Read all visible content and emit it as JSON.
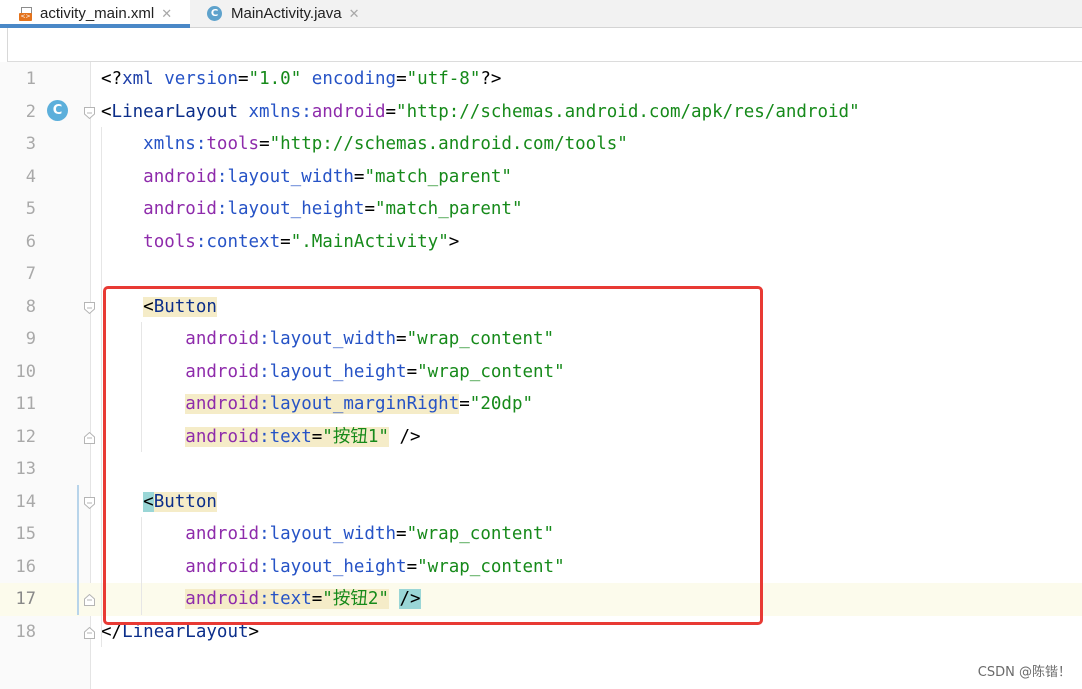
{
  "tabs": [
    {
      "label": "activity_main.xml",
      "icon": "xml-file-icon",
      "active": true
    },
    {
      "label": "MainActivity.java",
      "icon": "java-class-icon",
      "active": false
    }
  ],
  "tab_close_glyph": "✕",
  "gutter_badge": "C",
  "xml_icon_text": "<>",
  "lines": [
    {
      "n": "1",
      "parts": [
        [
          "plain",
          "<?"
        ],
        [
          "b",
          "xml "
        ],
        [
          "attr",
          "version"
        ],
        [
          "plain",
          "="
        ],
        [
          "str",
          "\"1.0\""
        ],
        [
          "plain",
          " "
        ],
        [
          "attr",
          "encoding"
        ],
        [
          "plain",
          "="
        ],
        [
          "str",
          "\"utf-8\""
        ],
        [
          "plain",
          "?>"
        ]
      ]
    },
    {
      "n": "2",
      "parts": [
        [
          "plain",
          "<"
        ],
        [
          "t",
          "LinearLayout "
        ],
        [
          "attr",
          "xmlns:"
        ],
        [
          "ns",
          "android"
        ],
        [
          "plain",
          "="
        ],
        [
          "str",
          "\"http://schemas.android.com/apk/res/android\""
        ]
      ]
    },
    {
      "n": "3",
      "parts": [
        [
          "plain",
          "    "
        ],
        [
          "attr",
          "xmlns:"
        ],
        [
          "ns",
          "tools"
        ],
        [
          "plain",
          "="
        ],
        [
          "str",
          "\"http://schemas.android.com/tools\""
        ]
      ]
    },
    {
      "n": "4",
      "parts": [
        [
          "plain",
          "    "
        ],
        [
          "ns",
          "android"
        ],
        [
          "attr",
          ":layout_width"
        ],
        [
          "plain",
          "="
        ],
        [
          "str",
          "\"match_parent\""
        ]
      ]
    },
    {
      "n": "5",
      "parts": [
        [
          "plain",
          "    "
        ],
        [
          "ns",
          "android"
        ],
        [
          "attr",
          ":layout_height"
        ],
        [
          "plain",
          "="
        ],
        [
          "str",
          "\"match_parent\""
        ]
      ]
    },
    {
      "n": "6",
      "parts": [
        [
          "plain",
          "    "
        ],
        [
          "ns",
          "tools"
        ],
        [
          "attr",
          ":context"
        ],
        [
          "plain",
          "="
        ],
        [
          "str",
          "\".MainActivity\""
        ],
        [
          "plain",
          ">"
        ]
      ]
    },
    {
      "n": "7",
      "parts": []
    },
    {
      "n": "8",
      "parts": [
        [
          "plain",
          "    "
        ],
        [
          "plain hl-tag",
          "<"
        ],
        [
          "t hl-tag",
          "Button"
        ]
      ]
    },
    {
      "n": "9",
      "parts": [
        [
          "plain",
          "        "
        ],
        [
          "ns",
          "android"
        ],
        [
          "attr",
          ":layout_width"
        ],
        [
          "plain",
          "="
        ],
        [
          "str",
          "\"wrap_content\""
        ]
      ]
    },
    {
      "n": "10",
      "parts": [
        [
          "plain",
          "        "
        ],
        [
          "ns",
          "android"
        ],
        [
          "attr",
          ":layout_height"
        ],
        [
          "plain",
          "="
        ],
        [
          "str",
          "\"wrap_content\""
        ]
      ]
    },
    {
      "n": "11",
      "parts": [
        [
          "plain",
          "        "
        ],
        [
          "ns hl-attr",
          "android"
        ],
        [
          "attr hl-attr",
          ":layout_marginRight"
        ],
        [
          "plain",
          "="
        ],
        [
          "str",
          "\"20dp\""
        ]
      ]
    },
    {
      "n": "12",
      "parts": [
        [
          "plain",
          "        "
        ],
        [
          "ns hl-attr",
          "android"
        ],
        [
          "attr hl-attr",
          ":text"
        ],
        [
          "plain hl-attr",
          "="
        ],
        [
          "str hl-attr",
          "\"按钮1\""
        ],
        [
          "plain",
          " />"
        ]
      ]
    },
    {
      "n": "13",
      "parts": []
    },
    {
      "n": "14",
      "parts": [
        [
          "plain",
          "    "
        ],
        [
          "plain hl-cyan",
          "<"
        ],
        [
          "t hl-tag",
          "Button"
        ]
      ]
    },
    {
      "n": "15",
      "parts": [
        [
          "plain",
          "        "
        ],
        [
          "ns",
          "android"
        ],
        [
          "attr",
          ":layout_width"
        ],
        [
          "plain",
          "="
        ],
        [
          "str",
          "\"wrap_content\""
        ]
      ]
    },
    {
      "n": "16",
      "parts": [
        [
          "plain",
          "        "
        ],
        [
          "ns",
          "android"
        ],
        [
          "attr",
          ":layout_height"
        ],
        [
          "plain",
          "="
        ],
        [
          "str",
          "\"wrap_content\""
        ]
      ]
    },
    {
      "n": "17",
      "parts": [
        [
          "plain",
          "        "
        ],
        [
          "ns hl-attr",
          "android"
        ],
        [
          "attr hl-attr",
          ":text"
        ],
        [
          "plain hl-attr",
          "="
        ],
        [
          "str hl-attr",
          "\"按钮2\""
        ],
        [
          "plain",
          " "
        ],
        [
          "plain hl-cyan",
          "/>"
        ]
      ]
    },
    {
      "n": "18",
      "parts": [
        [
          "plain",
          "<"
        ],
        [
          "plain",
          "/"
        ],
        [
          "t",
          "LinearLayout"
        ],
        [
          "plain",
          ">"
        ]
      ]
    }
  ],
  "current_line": "17",
  "watermark": "CSDN @陈锴！",
  "colors": {
    "highlight_box": "#e83a34",
    "string": "#168a1a",
    "namespace": "#8e2bab",
    "attribute": "#2653c6",
    "tag": "#0b2e8a"
  }
}
